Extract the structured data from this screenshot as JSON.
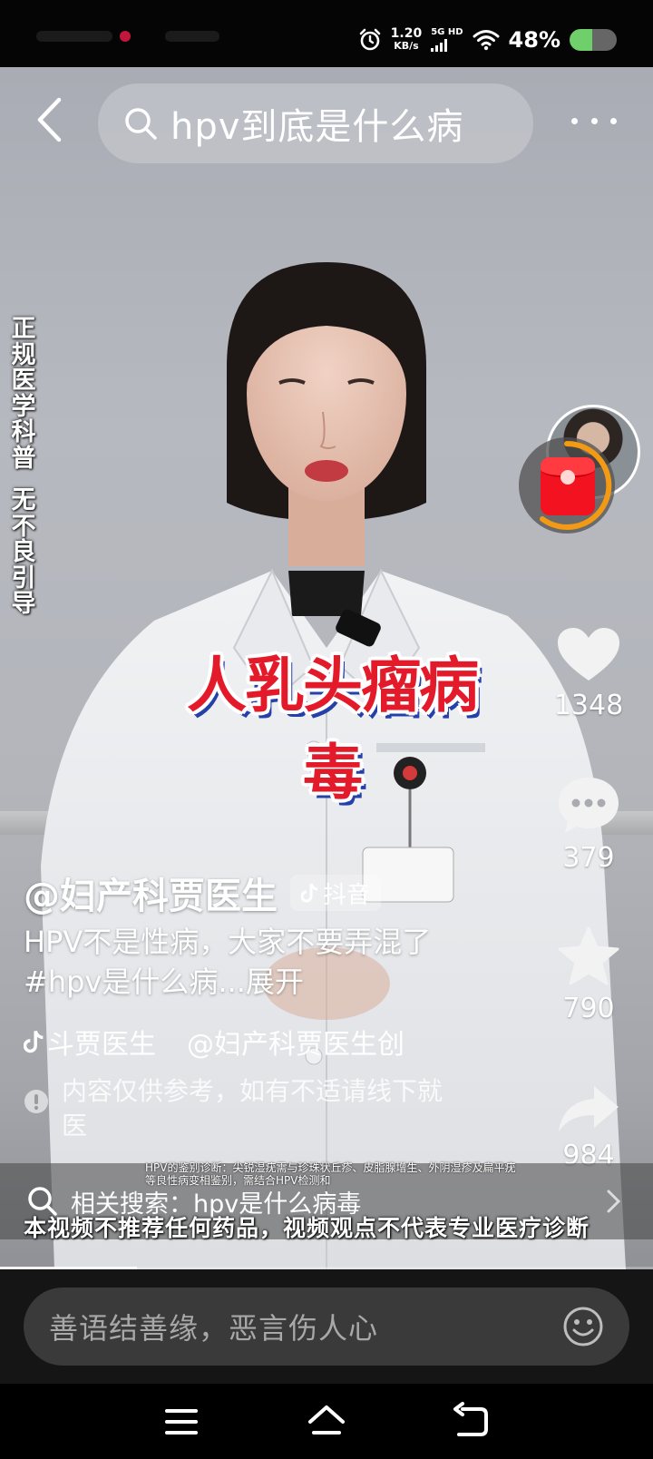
{
  "status_bar": {
    "net_speed": "1.20",
    "net_speed_unit": "KB/s",
    "network_type": "5G HD",
    "battery_percent": "48%",
    "battery_level": 0.48,
    "icons": [
      "alarm-icon",
      "signal-bars-icon",
      "wifi-icon",
      "battery-icon"
    ]
  },
  "search": {
    "query": "hpv到底是什么病"
  },
  "video": {
    "side_caption_1": "正规医学科普",
    "side_caption_2": "无不良引导",
    "overlay_title": "人乳头瘤病毒",
    "bottom_caption": "本视频不推荐任何药品，视频观点不代表专业医疗诊断",
    "tiny_caption": "HPV的鉴别诊断：尖锐湿疣需与珍珠状丘疹、皮脂腺增生、外阴湿疹及扁平疣等良性病变相鉴别，需结合HPV检测和",
    "progress": 0.21
  },
  "actions": {
    "likes": "1348",
    "comments": "379",
    "favorites": "790",
    "shares": "984"
  },
  "info": {
    "author": "@妇产科贾医生",
    "platform_tag": "抖音",
    "description": "HPV不是性病，大家不要弄混了 #hpv是什么病...展开",
    "music_1": "斗贾医生",
    "music_2": "@妇产科贾医生创",
    "disclaimer": "内容仅供参考，如有不适请线下就医"
  },
  "related": {
    "text": "相关搜索：hpv是什么病毒"
  },
  "comment": {
    "placeholder": "善语结善缘，恶言伤人心"
  },
  "colors": {
    "accent_red": "#e21a2a",
    "ring_orange": "#f39a14",
    "battery_green": "#6fcf6a"
  }
}
